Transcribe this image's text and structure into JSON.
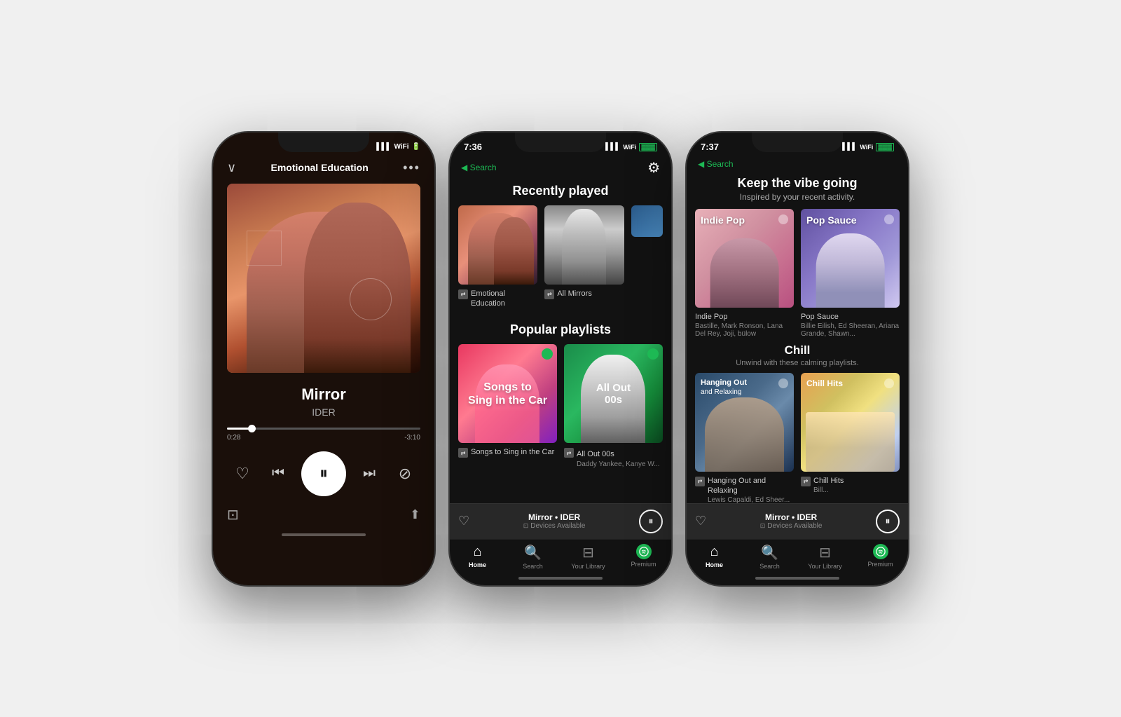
{
  "phones": [
    {
      "id": "phone1",
      "type": "now-playing",
      "status": {
        "left": "",
        "time": "",
        "right": ""
      },
      "header": {
        "title": "Emotional Education",
        "chevron": "∨",
        "dots": "•••"
      },
      "track": {
        "name": "Mirror",
        "artist": "IDER",
        "elapsed": "0:28",
        "remaining": "-3:10",
        "progress_pct": 13
      },
      "controls": {
        "heart": "♡",
        "skip_back": "⏮",
        "play_pause": "⏸",
        "skip_forward": "⏭",
        "block": "⊘"
      },
      "footer": {
        "devices": "⊡",
        "share": "↑"
      }
    },
    {
      "id": "phone2",
      "type": "home",
      "status": {
        "time": "7:36",
        "location": "↗"
      },
      "nav": {
        "back": "◀ Search",
        "gear": "⚙"
      },
      "recently_played": {
        "title": "Recently played",
        "items": [
          {
            "name": "Emotional Education",
            "art_type": "emotional",
            "has_shuffle": true
          },
          {
            "name": "All Mirrors",
            "art_type": "mirrors",
            "has_shuffle": true
          }
        ]
      },
      "popular_playlists": {
        "title": "Popular playlists",
        "items": [
          {
            "name": "Songs to Sing in the Car",
            "art_type": "songs_car",
            "has_shuffle": true,
            "text_overlay": "Songs to Sing in the Car"
          },
          {
            "name": "All Out 00s",
            "subtitle": "Daddy Yankee, Kanye W...",
            "art_type": "allout00s",
            "has_shuffle": true,
            "text_overlay": "All Out 00s"
          }
        ]
      },
      "now_playing": {
        "title": "Mirror • IDER",
        "device": "Devices Available"
      },
      "tabs": [
        {
          "icon": "home",
          "label": "Home",
          "active": true
        },
        {
          "icon": "search",
          "label": "Search",
          "active": false
        },
        {
          "icon": "library",
          "label": "Your Library",
          "active": false
        },
        {
          "icon": "spotify",
          "label": "Premium",
          "active": false
        }
      ]
    },
    {
      "id": "phone3",
      "type": "home-vibe",
      "status": {
        "time": "7:37",
        "location": "↗"
      },
      "nav": {
        "back": "◀ Search"
      },
      "header": {
        "title": "Keep the vibe going",
        "subtitle": "Inspired by your recent activity."
      },
      "sections": [
        {
          "title": "Keep the vibe going",
          "subtitle": "Inspired by your recent activity.",
          "items": [
            {
              "name": "Indie Pop",
              "art_type": "indiepop",
              "has_shuffle": false,
              "genre_label": "Indie Pop",
              "subtitle": "Bastille, Mark Ronson, Lana Del Rey, Joji, bülow"
            },
            {
              "name": "Pop Sauce",
              "art_type": "popsauce",
              "has_shuffle": false,
              "genre_label": "Pop Sauce",
              "subtitle": "Billie Eilish, Ed Sheeran, Ariana Grande, Shawn..."
            }
          ]
        },
        {
          "title": "Chill",
          "subtitle": "Unwind with these calming playlists.",
          "items": [
            {
              "name": "Hanging Out and Relaxing",
              "art_type": "hangingout",
              "has_shuffle": true,
              "subtitle": "Lewis Capaldi, Ed Sheer..."
            },
            {
              "name": "Chill Hits",
              "art_type": "chillhits",
              "has_shuffle": true,
              "subtitle": "Bill..."
            }
          ]
        }
      ],
      "now_playing": {
        "title": "Mirror • IDER",
        "device": "Devices Available"
      },
      "tabs": [
        {
          "icon": "home",
          "label": "Home",
          "active": true
        },
        {
          "icon": "search",
          "label": "Search",
          "active": false
        },
        {
          "icon": "library",
          "label": "Your Library",
          "active": false
        },
        {
          "icon": "spotify",
          "label": "Premium",
          "active": false
        }
      ]
    }
  ]
}
